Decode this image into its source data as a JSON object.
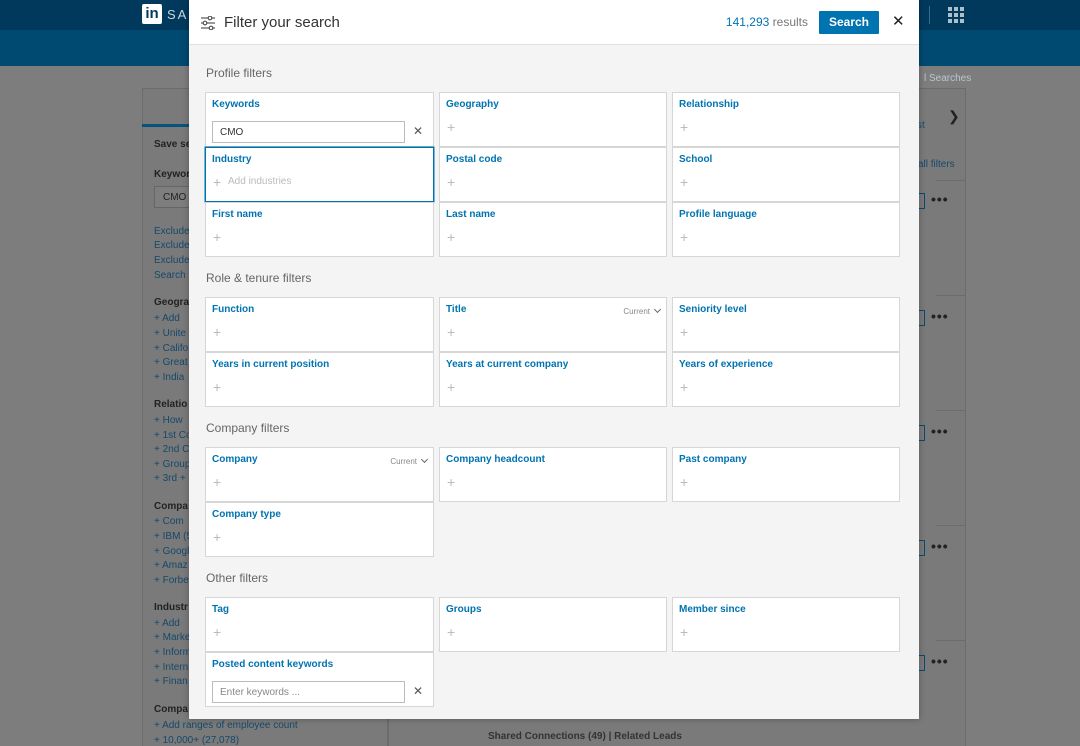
{
  "background": {
    "logo_text": "SAL",
    "saved_searches": "l Searches",
    "left_items": [
      {
        "text": "Save se",
        "kind": "h"
      },
      {
        "text": "Keywor",
        "kind": "h"
      },
      {
        "text": "CMO",
        "kind": "input"
      },
      {
        "text": "Exclude",
        "kind": "t"
      },
      {
        "text": "Exclude",
        "kind": "t"
      },
      {
        "text": "Exclude",
        "kind": "t"
      },
      {
        "text": "Search",
        "kind": "t"
      },
      {
        "text": "Geogra",
        "kind": "h"
      },
      {
        "text": "+ Add",
        "kind": "t"
      },
      {
        "text": "+ Unite",
        "kind": "t"
      },
      {
        "text": "+ Califo",
        "kind": "t"
      },
      {
        "text": "+ Great",
        "kind": "t"
      },
      {
        "text": "+ India",
        "kind": "t"
      },
      {
        "text": "Relatio",
        "kind": "h"
      },
      {
        "text": "+ How",
        "kind": "t"
      },
      {
        "text": "+ 1st Co",
        "kind": "t"
      },
      {
        "text": "+ 2nd C",
        "kind": "t"
      },
      {
        "text": "+ Group",
        "kind": "t"
      },
      {
        "text": "+ 3rd +",
        "kind": "t"
      },
      {
        "text": "Compa",
        "kind": "h"
      },
      {
        "text": "+ Com",
        "kind": "t"
      },
      {
        "text": "+ IBM (5",
        "kind": "t"
      },
      {
        "text": "+ Googl",
        "kind": "t"
      },
      {
        "text": "+ Amaz",
        "kind": "t"
      },
      {
        "text": "+ Forbe",
        "kind": "t"
      },
      {
        "text": "Industr",
        "kind": "h"
      },
      {
        "text": "+ Add",
        "kind": "t"
      },
      {
        "text": "+ Marke",
        "kind": "t"
      },
      {
        "text": "+ Inform",
        "kind": "t"
      },
      {
        "text": "+ Intern",
        "kind": "t"
      },
      {
        "text": "+ Finan",
        "kind": "t"
      },
      {
        "text": "Compa",
        "kind": "h"
      },
      {
        "text": "+ Add ranges of employee count",
        "kind": "t"
      },
      {
        "text": "+ 10,000+ (27,078)",
        "kind": "t"
      }
    ],
    "right_items": [
      {
        "text": "st",
        "kind": "t"
      },
      {
        "text": "all filters",
        "kind": "t"
      }
    ],
    "footer_text": "Shared Connections (49)  |  Related Leads"
  },
  "modal": {
    "title": "Filter your search",
    "results_count": "141,293",
    "results_label": "results",
    "search_label": "Search",
    "close_label": "✕",
    "sections": [
      {
        "title": "Profile filters",
        "cells": [
          {
            "label": "Keywords",
            "type": "input",
            "value": "CMO",
            "clear": "✕"
          },
          {
            "label": "Geography",
            "type": "add"
          },
          {
            "label": "Relationship",
            "type": "add"
          },
          {
            "label": "Industry",
            "type": "add",
            "placeholder": "Add industries",
            "active": true
          },
          {
            "label": "Postal code",
            "type": "add"
          },
          {
            "label": "School",
            "type": "add"
          },
          {
            "label": "First name",
            "type": "add"
          },
          {
            "label": "Last name",
            "type": "add"
          },
          {
            "label": "Profile language",
            "type": "add"
          }
        ]
      },
      {
        "title": "Role & tenure filters",
        "cells": [
          {
            "label": "Function",
            "type": "add"
          },
          {
            "label": "Title",
            "type": "add",
            "qualifier": "Current"
          },
          {
            "label": "Seniority level",
            "type": "add"
          },
          {
            "label": "Years in current position",
            "type": "add"
          },
          {
            "label": "Years at current company",
            "type": "add"
          },
          {
            "label": "Years of experience",
            "type": "add"
          }
        ]
      },
      {
        "title": "Company filters",
        "cells": [
          {
            "label": "Company",
            "type": "add",
            "qualifier": "Current"
          },
          {
            "label": "Company headcount",
            "type": "add"
          },
          {
            "label": "Past company",
            "type": "add"
          },
          {
            "label": "Company type",
            "type": "add"
          }
        ]
      },
      {
        "title": "Other filters",
        "cells": [
          {
            "label": "Tag",
            "type": "add"
          },
          {
            "label": "Groups",
            "type": "add"
          },
          {
            "label": "Member since",
            "type": "add"
          },
          {
            "label": "Posted content keywords",
            "type": "input",
            "placeholder": "Enter keywords ...",
            "clear": "✕"
          }
        ]
      }
    ],
    "add_glyph": "+"
  },
  "colors": {
    "accent": "#0073b1",
    "nav_dark": "#00395c",
    "nav": "#004971"
  },
  "icons": [
    "filter-sliders-icon",
    "close-icon",
    "plus-icon",
    "chevron-down-icon",
    "apps-grid-icon",
    "linkedin-logo-icon"
  ]
}
